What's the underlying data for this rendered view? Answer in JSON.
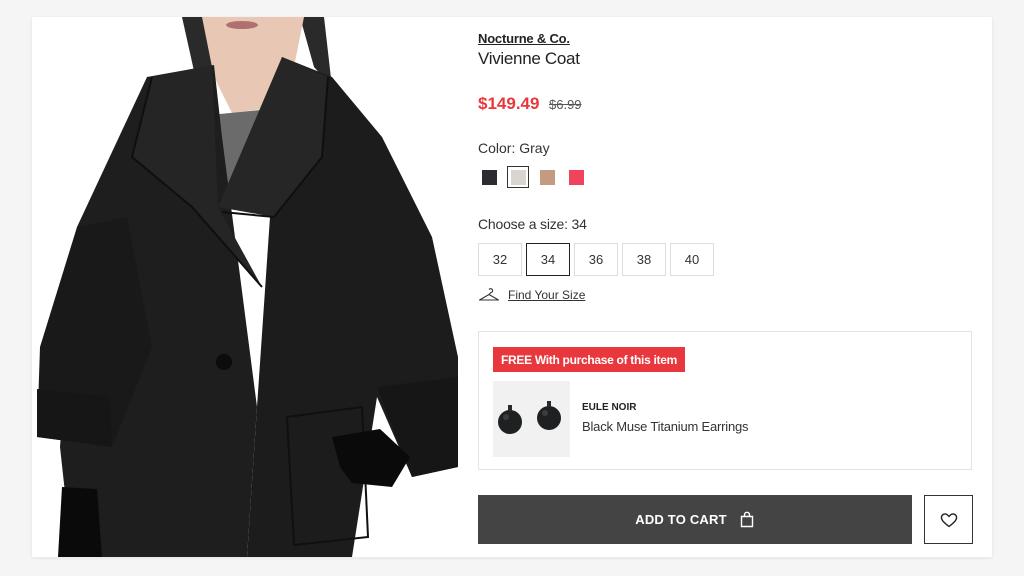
{
  "product": {
    "brand": "Nocturne & Co.",
    "name": "Vivienne Coat",
    "sale_price": "$149.49",
    "original_price": "$6.99",
    "image_icon": "coat-photo"
  },
  "color": {
    "label": "Color:",
    "selected": "Gray",
    "swatches": [
      {
        "name": "black",
        "hex": "#2b2d31"
      },
      {
        "name": "gray",
        "hex": "#d9d6d0"
      },
      {
        "name": "camel",
        "hex": "#c49a80"
      },
      {
        "name": "pink",
        "hex": "#f0445d"
      }
    ]
  },
  "size": {
    "label": "Choose a size:",
    "selected": "34",
    "options": [
      "32",
      "34",
      "36",
      "38",
      "40"
    ],
    "find_your_size": "Find Your Size"
  },
  "gift": {
    "tag": "FREE With purchase of this item",
    "brand": "EULE NOIR",
    "name": "Black Muse Titanium Earrings"
  },
  "actions": {
    "add_to_cart": "ADD TO CART",
    "wishlist_icon": "heart-icon",
    "bag_icon": "shopping-bag-icon"
  },
  "colors": {
    "sale": "#e8383d",
    "button": "#444444"
  }
}
